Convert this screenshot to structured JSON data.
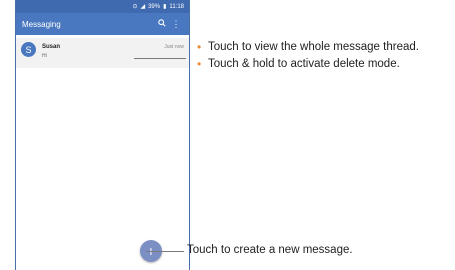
{
  "status_bar": {
    "battery": "39%",
    "time": "11:18"
  },
  "app_bar": {
    "title": "Messaging",
    "search_icon": "search-icon",
    "overflow_icon": "more-vert-icon"
  },
  "conversation": {
    "avatar_letter": "S",
    "name": "Susan",
    "snippet": "Hi",
    "time": "Just now"
  },
  "fab": {
    "icon": "plus-icon"
  },
  "annotations": {
    "bullets": [
      "Touch to view the whole message thread.",
      "Touch & hold to activate delete mode."
    ],
    "fab_note": "Touch to create a new message."
  },
  "colors": {
    "accent": "#4a78c0",
    "bullet": "#e88a3a"
  }
}
